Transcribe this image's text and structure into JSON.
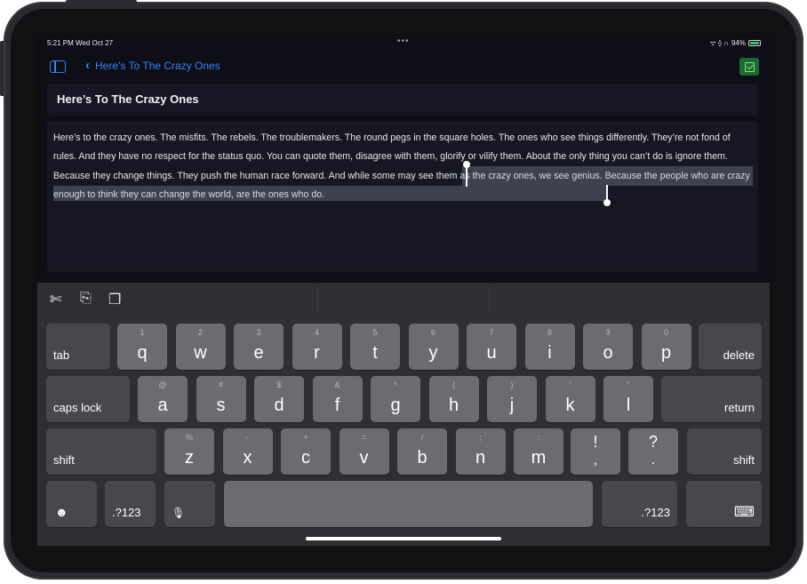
{
  "status_bar": {
    "time": "5:21 PM  Wed Oct 27",
    "dots": "•••",
    "signal": "ᯤ ⟠ ∩",
    "battery": "94%"
  },
  "nav": {
    "back_label": "Here’s To The Crazy Ones",
    "accent": "#3b82f6",
    "done_color": "#1e6a2e"
  },
  "note": {
    "title": "Here’s To The Crazy Ones",
    "body": "Here’s to the crazy ones. The misfits. The rebels. The troublemakers. The round pegs in the square holes. The ones who see things differently. They’re not fond of rules. And they have no respect for the status quo. You can quote them, disagree with them, glorify or vilify them. About the only thing you can’t do is ignore them. Because they change things. They push the human race forward. And while some may see them as the crazy ones, we see genius. Because the people who are crazy enough to think they can change the world, are the ones who do."
  },
  "keyboard": {
    "tools": [
      "scissors-icon",
      "copy-icon",
      "paste-icon"
    ],
    "row1": [
      {
        "k": "q",
        "h": "1"
      },
      {
        "k": "w",
        "h": "2"
      },
      {
        "k": "e",
        "h": "3"
      },
      {
        "k": "r",
        "h": "4"
      },
      {
        "k": "t",
        "h": "5"
      },
      {
        "k": "y",
        "h": "6"
      },
      {
        "k": "u",
        "h": "7"
      },
      {
        "k": "i",
        "h": "8"
      },
      {
        "k": "o",
        "h": "9"
      },
      {
        "k": "p",
        "h": "0"
      }
    ],
    "row2": [
      {
        "k": "a",
        "h": "@"
      },
      {
        "k": "s",
        "h": "#"
      },
      {
        "k": "d",
        "h": "$"
      },
      {
        "k": "f",
        "h": "&"
      },
      {
        "k": "g",
        "h": "*"
      },
      {
        "k": "h",
        "h": "("
      },
      {
        "k": "j",
        "h": ")"
      },
      {
        "k": "k",
        "h": "’"
      },
      {
        "k": "l",
        "h": "\""
      }
    ],
    "row3": [
      {
        "k": "z",
        "h": "%"
      },
      {
        "k": "x",
        "h": "-"
      },
      {
        "k": "c",
        "h": "+"
      },
      {
        "k": "v",
        "h": "="
      },
      {
        "k": "b",
        "h": "/"
      },
      {
        "k": "n",
        "h": ";"
      },
      {
        "k": "m",
        "h": ":"
      }
    ],
    "punct1": {
      "top": "!",
      "bottom": ","
    },
    "punct2": {
      "top": "?",
      "bottom": "."
    },
    "tab": "tab",
    "delete": "delete",
    "caps_lock": "caps lock",
    "return": "return",
    "shift": "shift",
    "numbers": ".?123",
    "emoji": "☻",
    "mic": "🎙",
    "keyboard_hide": "⌨"
  }
}
